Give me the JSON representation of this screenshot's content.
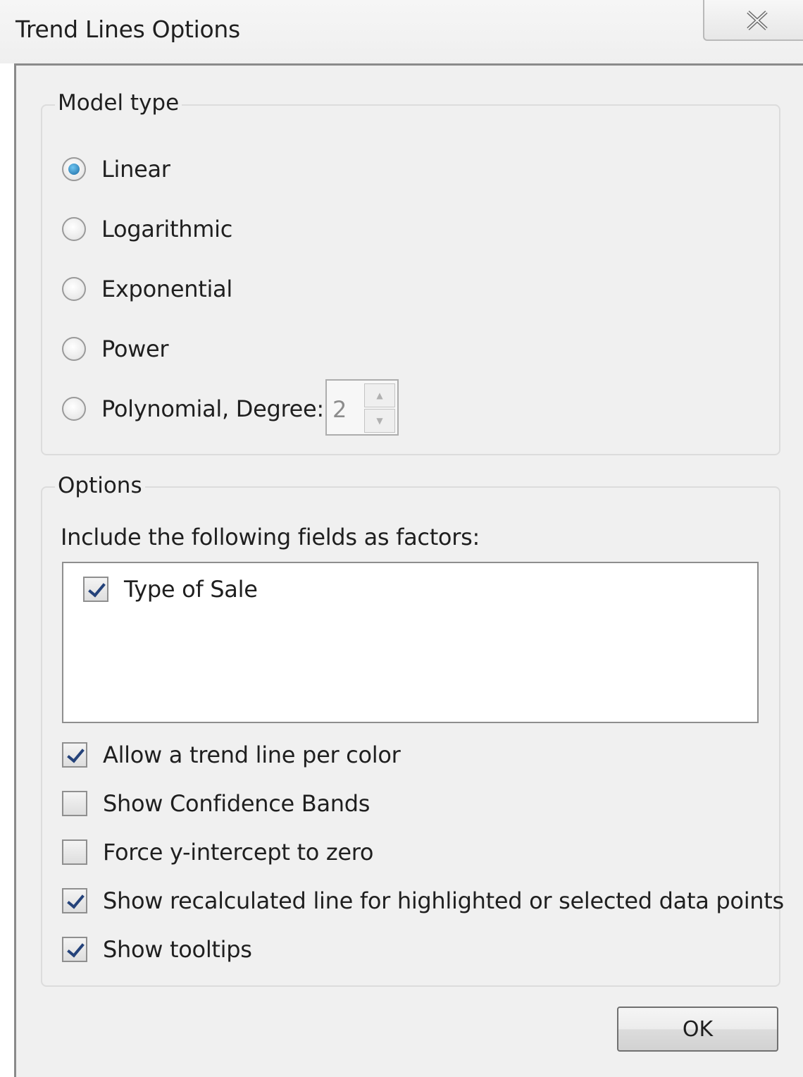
{
  "dialog": {
    "title": "Trend Lines Options",
    "close_icon": "close-x-icon"
  },
  "model_type": {
    "title": "Model type",
    "options": [
      {
        "label": "Linear",
        "checked": true
      },
      {
        "label": "Logarithmic",
        "checked": false
      },
      {
        "label": "Exponential",
        "checked": false
      },
      {
        "label": "Power",
        "checked": false
      },
      {
        "label": "Polynomial, Degree:",
        "checked": false
      }
    ],
    "degree": {
      "value": "2",
      "enabled": false
    }
  },
  "options": {
    "title": "Options",
    "factors_label": "Include the following fields as factors:",
    "factors": [
      {
        "label": "Type of Sale",
        "checked": true
      }
    ],
    "checkboxes": [
      {
        "label": "Allow a trend line per color",
        "checked": true
      },
      {
        "label": "Show Confidence Bands",
        "checked": false
      },
      {
        "label": "Force y-intercept to zero",
        "checked": false
      },
      {
        "label": "Show recalculated line for highlighted or selected data points",
        "checked": true
      },
      {
        "label": "Show tooltips",
        "checked": true
      }
    ]
  },
  "buttons": {
    "ok_label": "OK"
  }
}
